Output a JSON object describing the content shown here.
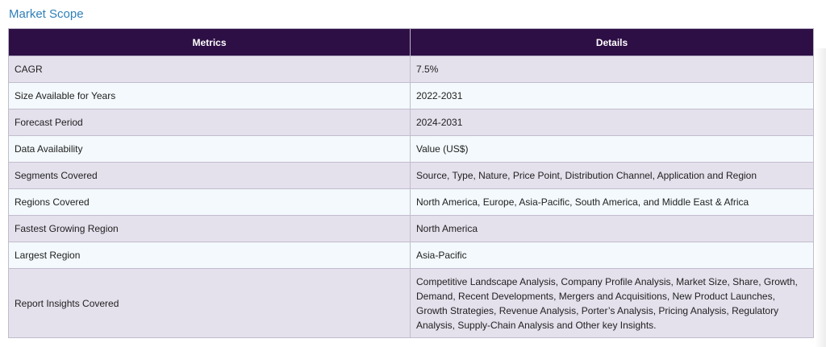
{
  "section": {
    "title": "Market Scope"
  },
  "table": {
    "headers": [
      "Metrics",
      "Details"
    ],
    "rows": [
      {
        "metric": "CAGR",
        "detail": "7.5%"
      },
      {
        "metric": "Size Available for Years",
        "detail": "2022-2031"
      },
      {
        "metric": "Forecast Period",
        "detail": "2024-2031"
      },
      {
        "metric": "Data Availability",
        "detail": "Value (US$)"
      },
      {
        "metric": "Segments Covered",
        "detail": "Source, Type, Nature, Price Point, Distribution Channel, Application and Region"
      },
      {
        "metric": "Regions Covered",
        "detail": "North America, Europe, Asia-Pacific, South America, and Middle East & Africa"
      },
      {
        "metric": "Fastest Growing Region",
        "detail": "North America"
      },
      {
        "metric": "Largest Region",
        "detail": "Asia-Pacific"
      },
      {
        "metric": "Report Insights Covered",
        "detail": "Competitive Landscape Analysis, Company Profile Analysis, Market Size, Share, Growth, Demand, Recent Developments, Mergers and Acquisitions, New Product Launches, Growth Strategies, Revenue Analysis, Porter’s Analysis, Pricing Analysis, Regulatory Analysis, Supply-Chain Analysis and Other key Insights."
      }
    ]
  },
  "colors": {
    "header_bg": "#2d0f45",
    "row_odd": "#e4e0ec",
    "row_even": "#f3f9fc",
    "title": "#2f7fb8"
  }
}
